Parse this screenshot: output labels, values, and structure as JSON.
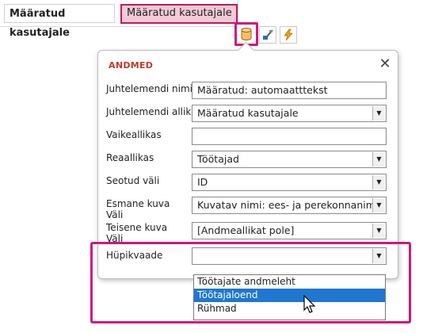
{
  "top_bar": {
    "label": "Määratud kasutajale",
    "value": "Määratud kasutajale"
  },
  "toolbar": {
    "data_icon": "database-icon",
    "format_icon": "format-brush-icon",
    "event_icon": "lightning-icon"
  },
  "panel": {
    "title": "ANDMED",
    "close_icon": "close-icon",
    "fields": {
      "control_name": {
        "label": "Juhtelemendi nimi",
        "value": "Määratud: automaatttekst"
      },
      "control_source": {
        "label": "Juhtelemendi allikas",
        "value": "Määratud kasutajale"
      },
      "default_value": {
        "label": "Vaikeallikas",
        "value": ""
      },
      "row_source": {
        "label": "Reaallikas",
        "value": "Töötajad"
      },
      "bound_field": {
        "label": "Seotud väli",
        "value": "ID"
      },
      "primary_display": {
        "label_line1": "Esmane kuva",
        "label_line2": "Väli",
        "value": "Kuvatav nimi: ees- ja perekonnanimi"
      },
      "secondary_display": {
        "label_line1": "Teisene kuva",
        "label_line2": "Väli",
        "value": "[Andmeallikat pole]"
      },
      "popup_view": {
        "label": "Hüpikvaade",
        "value": ""
      }
    }
  },
  "popup_dropdown": {
    "options": [
      "Töötajate andmeleht",
      "Töötajaloend",
      "Rühmad"
    ],
    "selected_index": 1
  },
  "colors": {
    "highlight": "#d0167e",
    "panel_title": "#c0392b",
    "selection": "#1f77d0",
    "top_value_bg": "#f1cad6"
  }
}
